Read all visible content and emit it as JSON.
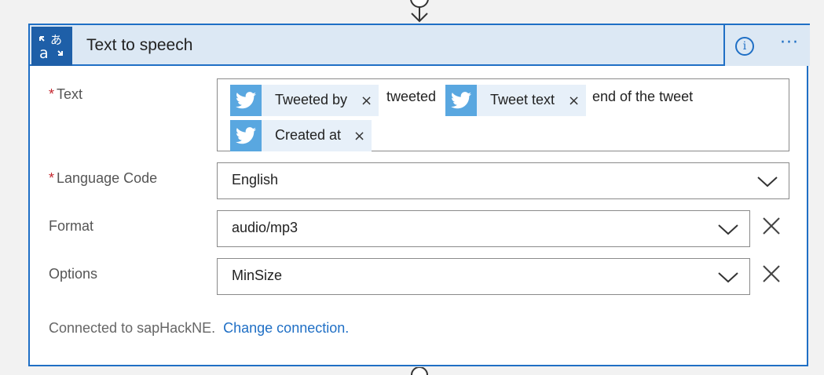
{
  "header": {
    "title": "Text to speech",
    "info_glyph": "i",
    "more_glyph": "···",
    "icon": "translate-icon"
  },
  "fields": {
    "text": {
      "label": "Text",
      "required": "*",
      "tokens": [
        {
          "label": "Tweeted by",
          "icon": "twitter-icon"
        },
        {
          "label": "Tweet text",
          "icon": "twitter-icon"
        },
        {
          "label": "Created at",
          "icon": "twitter-icon"
        }
      ],
      "literals": [
        "tweeted",
        "end of the tweet"
      ],
      "remove_glyph": "×"
    },
    "language_code": {
      "label": "Language Code",
      "required": "*",
      "value": "English"
    },
    "format": {
      "label": "Format",
      "value": "audio/mp3"
    },
    "options": {
      "label": "Options",
      "value": "MinSize"
    }
  },
  "footer": {
    "connected_text": "Connected to sapHackNE.",
    "change_link": "Change connection."
  },
  "colors": {
    "accent": "#1f6fc5",
    "header_bg": "#dce8f4",
    "twitter": "#59a7e0",
    "token_bg": "#e7f0f9",
    "required": "#c4262e"
  }
}
